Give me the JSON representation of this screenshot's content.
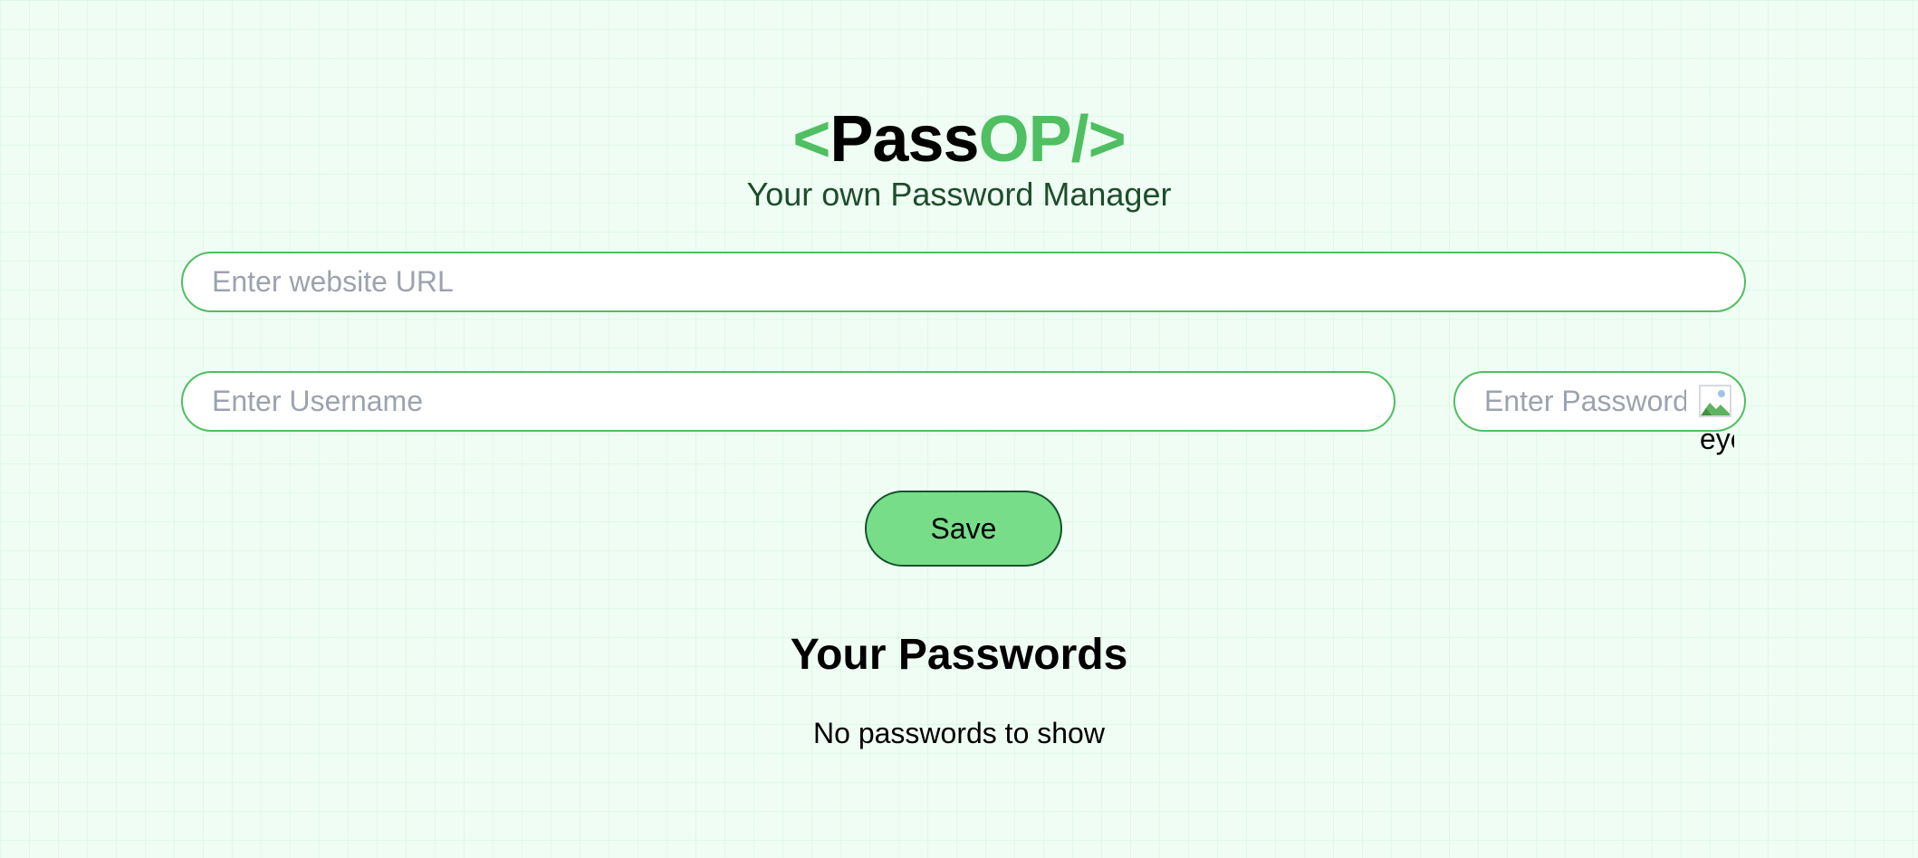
{
  "logo": {
    "open": "<",
    "name_main": "Pass",
    "name_accent": "OP/>"
  },
  "tagline": "Your own Password Manager",
  "form": {
    "website_placeholder": "Enter website URL",
    "website_value": "",
    "username_placeholder": "Enter Username",
    "username_value": "",
    "password_placeholder": "Enter Password",
    "password_value": "",
    "toggle_icon": "eye-icon",
    "toggle_alt_text": "eye",
    "save_label": "Save"
  },
  "passwords": {
    "title": "Your Passwords",
    "empty_message": "No passwords to show",
    "items": []
  },
  "colors": {
    "accent": "#4fbf61",
    "button": "#77dd89",
    "background": "#f0fdf4"
  }
}
